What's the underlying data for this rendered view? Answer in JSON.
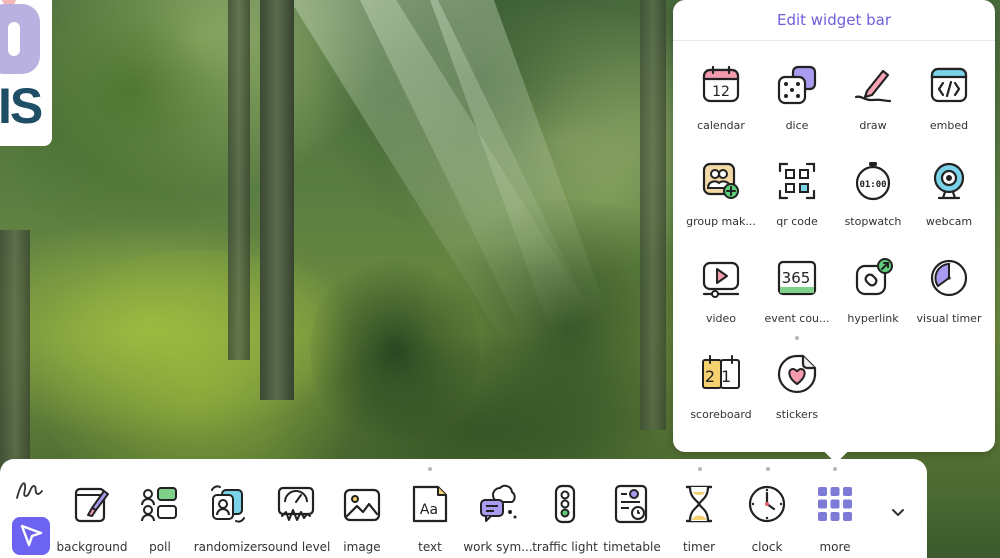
{
  "logo": {
    "text": "IS"
  },
  "popup": {
    "title": "Edit widget bar",
    "items": [
      {
        "label": "calendar",
        "icon": "calendar-icon",
        "badge": "12"
      },
      {
        "label": "dice",
        "icon": "dice-icon"
      },
      {
        "label": "draw",
        "icon": "pencil-draw-icon"
      },
      {
        "label": "embed",
        "icon": "embed-code-icon"
      },
      {
        "label": "group mak...",
        "icon": "group-maker-icon"
      },
      {
        "label": "qr code",
        "icon": "qr-code-icon"
      },
      {
        "label": "stopwatch",
        "icon": "stopwatch-icon",
        "badge": "01:00"
      },
      {
        "label": "webcam",
        "icon": "webcam-icon"
      },
      {
        "label": "video",
        "icon": "video-icon"
      },
      {
        "label": "event cou...",
        "icon": "event-countdown-icon",
        "badge": "365"
      },
      {
        "label": "hyperlink",
        "icon": "hyperlink-icon"
      },
      {
        "label": "visual timer",
        "icon": "visual-timer-icon"
      },
      {
        "label": "scoreboard",
        "icon": "scoreboard-icon",
        "badge": "21"
      },
      {
        "label": "stickers",
        "icon": "sticker-heart-icon"
      }
    ]
  },
  "toolbar": {
    "tools": [
      {
        "label": "background",
        "icon": "background-brush-icon"
      },
      {
        "label": "poll",
        "icon": "poll-icon"
      },
      {
        "label": "randomizer",
        "icon": "randomizer-icon"
      },
      {
        "label": "sound level",
        "icon": "sound-level-icon"
      },
      {
        "label": "image",
        "icon": "image-icon"
      },
      {
        "label": "text",
        "icon": "text-icon",
        "badge": "Aa"
      },
      {
        "label": "work sym...",
        "icon": "work-symbols-icon"
      },
      {
        "label": "traffic light",
        "icon": "traffic-light-icon"
      },
      {
        "label": "timetable",
        "icon": "timetable-icon"
      },
      {
        "label": "timer",
        "icon": "hourglass-timer-icon"
      },
      {
        "label": "clock",
        "icon": "clock-icon"
      },
      {
        "label": "more",
        "icon": "more-grid-icon"
      }
    ]
  },
  "colors": {
    "accent": "#6c63f0",
    "title": "#6e5fdc"
  }
}
